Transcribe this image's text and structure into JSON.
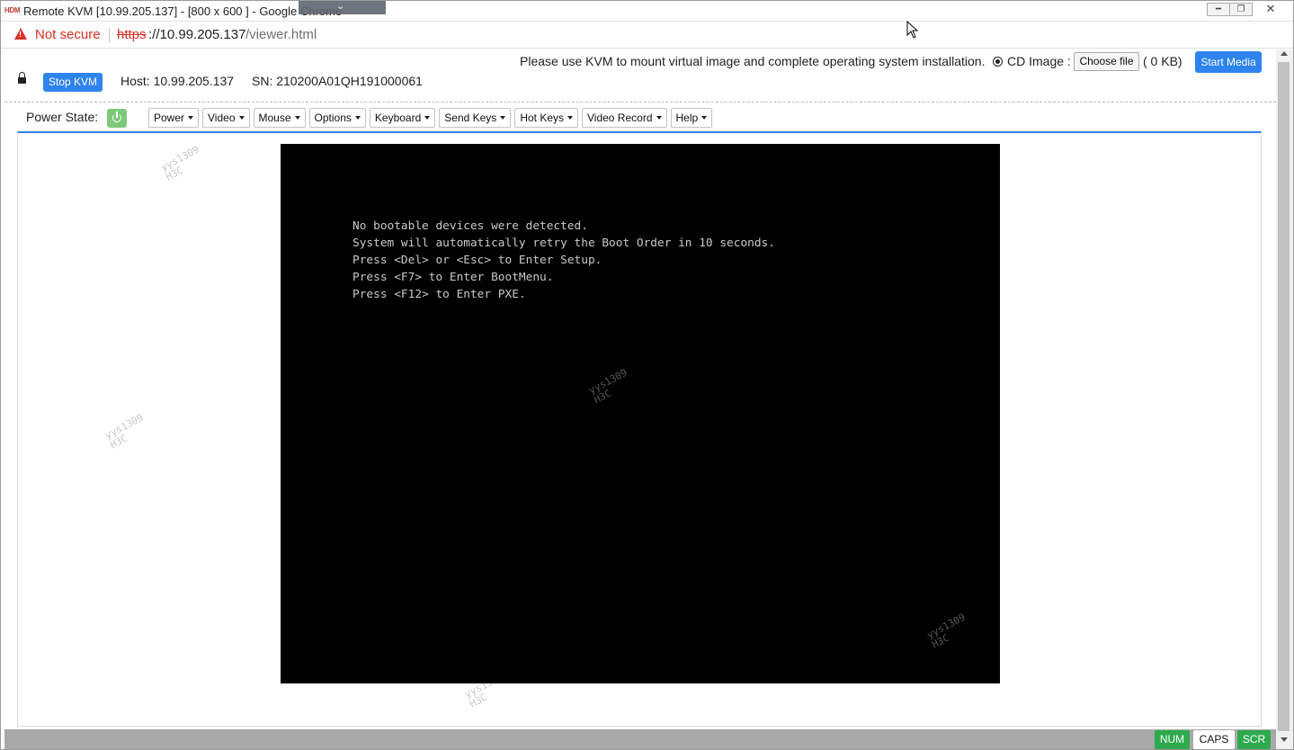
{
  "window": {
    "app_logo": "HDM",
    "title": "Remote KVM [10.99.205.137] - [800 x 600 ] - Google Chrome",
    "minimize_icon": "minimize-icon",
    "maximize_icon": "restore-icon",
    "close_icon": "close-icon"
  },
  "address_bar": {
    "security_label": "Not secure",
    "url_scheme": "https",
    "url_host": "://10.99.205.137",
    "url_path": "/viewer.html"
  },
  "header": {
    "notice": "Please use KVM to mount virtual image and complete operating system installation.",
    "cd_image_label": "CD Image :",
    "choose_file_label": "Choose file",
    "file_size": "( 0 KB)",
    "start_media_label": "Start Media",
    "stop_kvm_label": "Stop KVM",
    "host": "Host: 10.99.205.137",
    "sn": "SN: 210200A01QH191000061"
  },
  "toolbar": {
    "power_state_label": "Power State:",
    "menus": [
      "Power",
      "Video",
      "Mouse",
      "Options",
      "Keyboard",
      "Send Keys",
      "Hot Keys",
      "Video Record",
      "Help"
    ]
  },
  "screen": {
    "lines": [
      "No bootable devices were detected.",
      "System will automatically retry the Boot Order in 10 seconds.",
      "",
      "Press <Del> or <Esc> to Enter Setup.",
      "Press <F7> to Enter BootMenu.",
      "Press <F12> to Enter PXE."
    ]
  },
  "watermark": {
    "line1": "yys1309",
    "line2": "H3C"
  },
  "status_keys": {
    "num": "NUM",
    "caps": "CAPS",
    "scr": "SCR"
  },
  "colors": {
    "primary_button": "#2f83ee",
    "power_on": "#7cc97c",
    "key_active": "#2daa4e",
    "warning": "#d93025"
  }
}
